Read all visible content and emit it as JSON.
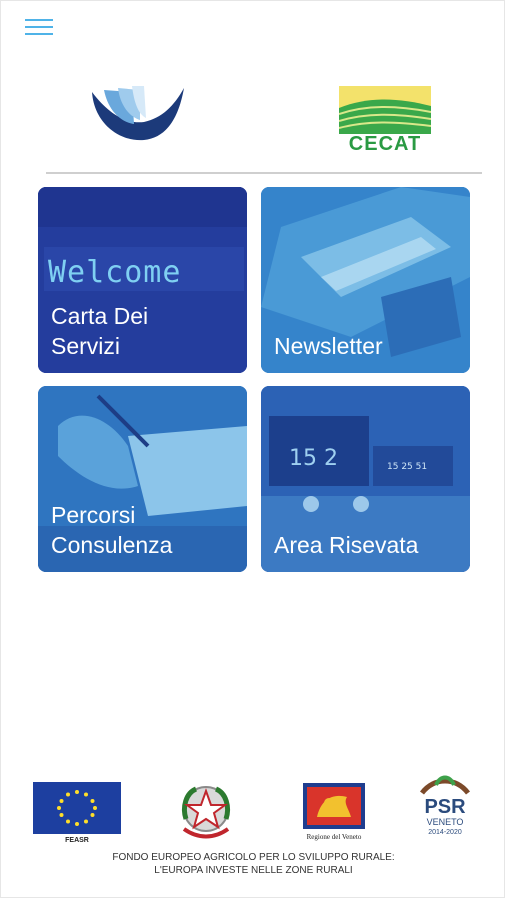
{
  "header": {
    "menu_icon": "hamburger-menu-icon",
    "logo_left_icon": "wing-logo-icon",
    "logo_right_text": "CECAT"
  },
  "tiles": [
    {
      "label": "Carta Dei\nServizi",
      "overlay_text": "Welcome"
    },
    {
      "label": "Newsletter"
    },
    {
      "label": "Percorsi\nConsulenza"
    },
    {
      "label": "Area Risevata",
      "clock_text": "15 2",
      "screen_text": "15 25 51"
    }
  ],
  "footer": {
    "eu_caption": "FEASR",
    "veneto_caption": "Regione del Veneto",
    "psr_title": "PSR",
    "psr_sub": "VENETO",
    "psr_years": "2014-2020",
    "text_line1": "FONDO EUROPEO AGRICOLO PER LO SVILUPPO RURALE:",
    "text_line2": "L'EUROPA INVESTE NELLE ZONE RURALI"
  },
  "colors": {
    "accent": "#4fb3e8",
    "tile_blue": "#2a5cb1",
    "cecat_green": "#2a9a43"
  }
}
